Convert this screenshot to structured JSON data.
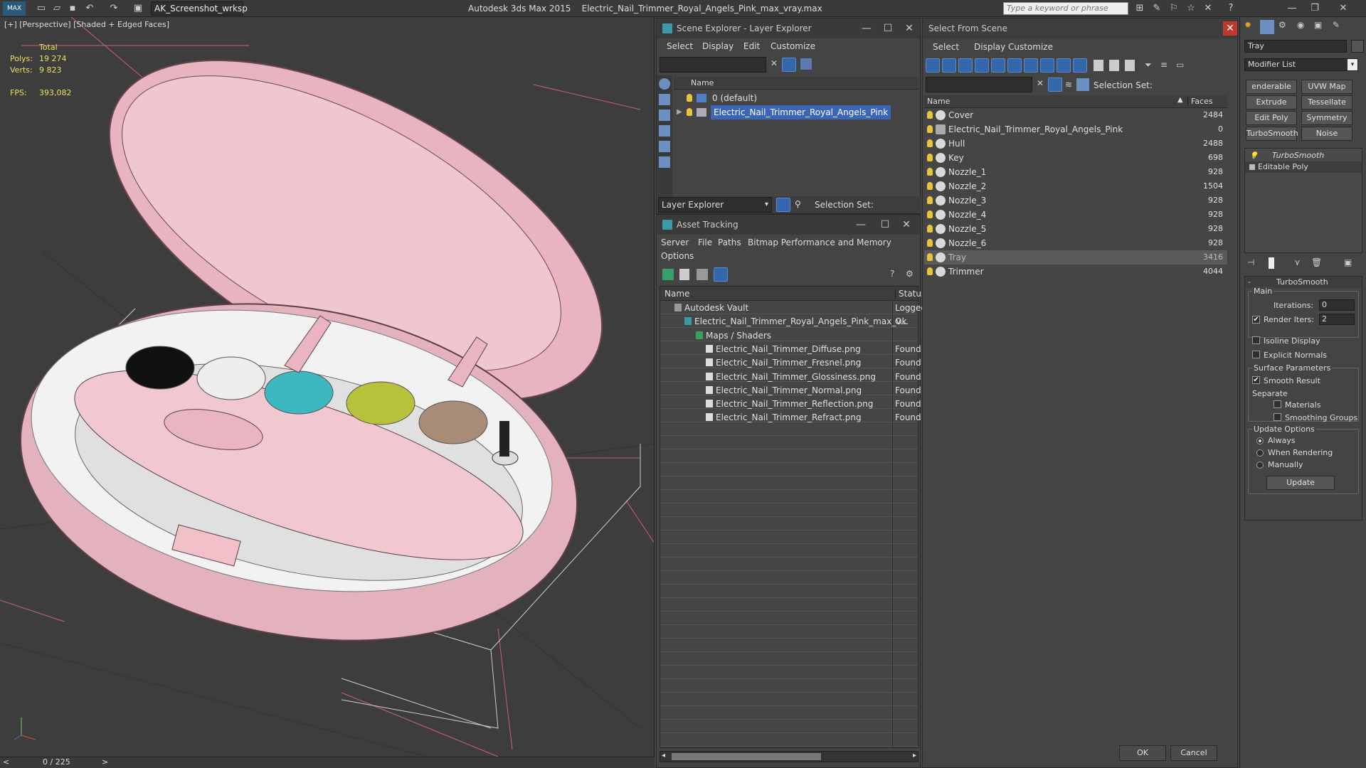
{
  "app": {
    "title": "Autodesk 3ds Max  2015",
    "file": "Electric_Nail_Trimmer_Royal_Angels_Pink_max_vray.max",
    "workspace": "AK_Screenshot_wrksp",
    "search_placeholder": "Type a keyword or phrase",
    "logo": "MAX"
  },
  "viewport": {
    "label": "[+] [Perspective] [Shaded + Edged Faces]",
    "stats_total": "Total",
    "polys_label": "Polys:",
    "polys_value": "19 274",
    "verts_label": "Verts:",
    "verts_value": "9 823",
    "fps_label": "FPS:",
    "fps_value": "393,082",
    "timeline": "0 / 225",
    "nav_prev": "<",
    "nav_next": ">"
  },
  "scene_explorer": {
    "title": "Scene Explorer - Layer Explorer",
    "menu": [
      "Select",
      "Display",
      "Edit",
      "Customize"
    ],
    "column": "Name",
    "layers": [
      "0 (default)",
      "Electric_Nail_Trimmer_Royal_Angels_Pink"
    ],
    "footer_dropdown": "Layer Explorer",
    "selection_set": "Selection Set:"
  },
  "asset_tracking": {
    "title": "Asset Tracking",
    "menu": [
      "Server",
      "File",
      "Paths",
      "Bitmap Performance and Memory",
      "Options"
    ],
    "col_name": "Name",
    "col_status": "Status",
    "rows": [
      {
        "name": "Autodesk Vault",
        "status": "Logged"
      },
      {
        "name": "Electric_Nail_Trimmer_Royal_Angels_Pink_max_v...",
        "status": "Ok"
      },
      {
        "name": "Maps / Shaders",
        "status": ""
      },
      {
        "name": "Electric_Nail_Trimmer_Diffuse.png",
        "status": "Found"
      },
      {
        "name": "Electric_Nail_Trimmer_Fresnel.png",
        "status": "Found"
      },
      {
        "name": "Electric_Nail_Trimmer_Glossiness.png",
        "status": "Found"
      },
      {
        "name": "Electric_Nail_Trimmer_Normal.png",
        "status": "Found"
      },
      {
        "name": "Electric_Nail_Trimmer_Reflection.png",
        "status": "Found"
      },
      {
        "name": "Electric_Nail_Trimmer_Refract.png",
        "status": "Found"
      }
    ]
  },
  "select_from_scene": {
    "title": "Select From Scene",
    "menu": [
      "Select",
      "Display",
      "Customize"
    ],
    "selection_set": "Selection Set:",
    "col_name": "Name",
    "col_faces": "Faces",
    "rows": [
      {
        "name": "Cover",
        "faces": "2484"
      },
      {
        "name": "Electric_Nail_Trimmer_Royal_Angels_Pink",
        "faces": "0"
      },
      {
        "name": "Hull",
        "faces": "2488"
      },
      {
        "name": "Key",
        "faces": "698"
      },
      {
        "name": "Nozzle_1",
        "faces": "928"
      },
      {
        "name": "Nozzle_2",
        "faces": "1504"
      },
      {
        "name": "Nozzle_3",
        "faces": "928"
      },
      {
        "name": "Nozzle_4",
        "faces": "928"
      },
      {
        "name": "Nozzle_5",
        "faces": "928"
      },
      {
        "name": "Nozzle_6",
        "faces": "928"
      },
      {
        "name": "Tray",
        "faces": "3416"
      },
      {
        "name": "Trimmer",
        "faces": "4044"
      }
    ],
    "ok": "OK",
    "cancel": "Cancel"
  },
  "command_panel": {
    "object_name": "Tray",
    "modifier_list": "Modifier List",
    "buttons": [
      "enderable Spli",
      "UVW Map",
      "Extrude",
      "Tessellate",
      "Edit Poly",
      "Symmetry",
      "TurboSmooth",
      "Noise"
    ],
    "stack": [
      "TurboSmooth",
      "Editable Poly"
    ],
    "rollout": "TurboSmooth",
    "main": "Main",
    "iterations_label": "Iterations:",
    "iterations": "0",
    "render_iters_label": "Render Iters:",
    "render_iters": "2",
    "isoline": "Isoline Display",
    "explicit": "Explicit Normals",
    "surface": "Surface Parameters",
    "smooth_result": "Smooth Result",
    "separate": "Separate",
    "materials": "Materials",
    "smoothing_groups": "Smoothing Groups",
    "update_options": "Update Options",
    "always": "Always",
    "when_rendering": "When Rendering",
    "manually": "Manually",
    "update": "Update"
  }
}
